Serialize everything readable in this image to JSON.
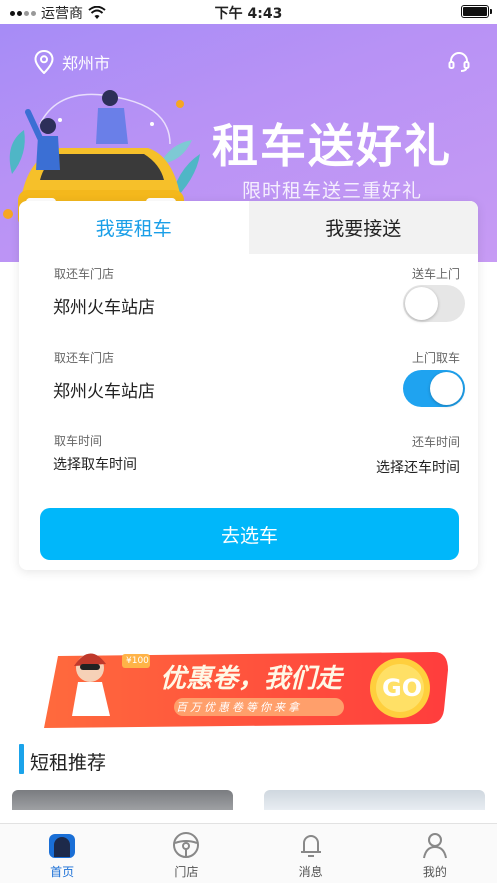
{
  "status_bar": {
    "carrier": "运营商",
    "time": "下午 4:43"
  },
  "hero": {
    "city": "郑州市",
    "title": "租车送好礼",
    "subtitle": "限时租车送三重好礼",
    "icons": [
      "location-pin-icon",
      "headset-icon"
    ]
  },
  "booking": {
    "tabs": [
      {
        "label": "我要租车",
        "active": true
      },
      {
        "label": "我要接送",
        "active": false
      }
    ],
    "pickup": {
      "label": "取还车门店",
      "store": "郑州火车站店",
      "option_label": "送车上门",
      "option_on": false
    },
    "return": {
      "label": "取还车门店",
      "store": "郑州火车站店",
      "option_label": "上门取车",
      "option_on": true
    },
    "time": {
      "pickup_label": "取车时间",
      "pickup_value": "选择取车时间",
      "return_label": "还车时间",
      "return_value": "选择还车时间"
    },
    "submit_label": "去选车"
  },
  "banner": {
    "title": "优惠卷，我们走",
    "subtitle": "百万优惠卷等你来拿",
    "go_label": "GO",
    "tag": "¥100"
  },
  "section": {
    "title": "短租推荐"
  },
  "tabbar": [
    {
      "label": "首页",
      "icon": "home-icon",
      "active": true
    },
    {
      "label": "门店",
      "icon": "steering-wheel-icon",
      "active": false
    },
    {
      "label": "消息",
      "icon": "bell-icon",
      "active": false
    },
    {
      "label": "我的",
      "icon": "user-icon",
      "active": false
    }
  ],
  "colors": {
    "accent": "#00b7fa",
    "tab_active": "#1a9fe8",
    "hero_bg": "#b892f5"
  }
}
